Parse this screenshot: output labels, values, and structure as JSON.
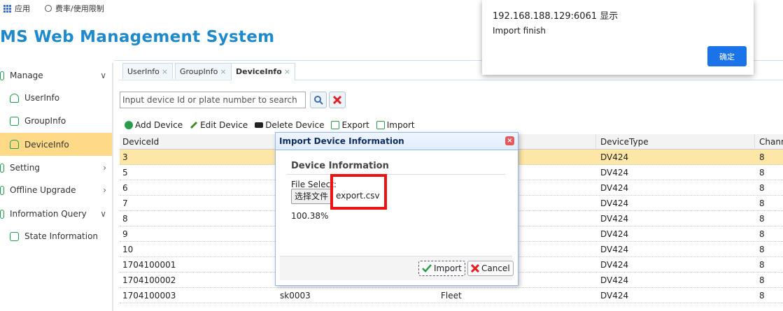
{
  "bookmarks": {
    "apps": "应用",
    "rates": "费率/使用限制"
  },
  "app_title": "MS Web Management System",
  "sidebar": {
    "items": [
      {
        "label": "Manage",
        "chevron": "∨"
      },
      {
        "label": "UserInfo"
      },
      {
        "label": "GroupInfo"
      },
      {
        "label": "DeviceInfo"
      },
      {
        "label": "Setting",
        "chevron": "›"
      },
      {
        "label": "Offline Upgrade",
        "chevron": "›"
      },
      {
        "label": "Information Query",
        "chevron": "∨"
      },
      {
        "label": "State Information"
      }
    ]
  },
  "tabs": [
    {
      "label": "UserInfo",
      "close": "×"
    },
    {
      "label": "GroupInfo",
      "close": "×"
    },
    {
      "label": "DeviceInfo",
      "close": "×"
    }
  ],
  "search": {
    "placeholder": "Input  device Id or plate number to search"
  },
  "toolbar": {
    "add": "Add Device",
    "edit": "Edit Device",
    "delete": "Delete Device",
    "export": "Export",
    "import": "Import"
  },
  "table": {
    "headers": [
      "DeviceId",
      "",
      "",
      "DeviceType",
      "Channe"
    ],
    "rows": [
      [
        "3",
        "",
        "",
        "DV424",
        "8"
      ],
      [
        "5",
        "",
        "",
        "DV424",
        "8"
      ],
      [
        "6",
        "",
        "",
        "DV424",
        "8"
      ],
      [
        "7",
        "",
        "",
        "DV424",
        "8"
      ],
      [
        "8",
        "",
        "",
        "DV424",
        "8"
      ],
      [
        "9",
        "",
        "",
        "DV424",
        "8"
      ],
      [
        "10",
        "",
        "",
        "DV424",
        "8"
      ],
      [
        "1704100001",
        "",
        "",
        "DV424",
        "8"
      ],
      [
        "1704100002",
        "",
        "",
        "DV424",
        "8"
      ],
      [
        "1704100003",
        "sk0003",
        "Fleet",
        "DV424",
        "8"
      ]
    ]
  },
  "dialog": {
    "title": "Import Device Information",
    "close": "×",
    "section_title": "Device Information",
    "file_label": "File Select:",
    "file_button": "选择文件",
    "file_name": "export.csv",
    "progress": "100.38%",
    "import_button": "Import",
    "cancel_button": "Cancel"
  },
  "alert": {
    "title": "192.168.188.129:6061 显示",
    "message": "Import finish",
    "ok": "确定"
  },
  "colors": {
    "brand": "#1f8acb",
    "active_row": "#fde6a6",
    "highlight_box": "#ee1111"
  }
}
